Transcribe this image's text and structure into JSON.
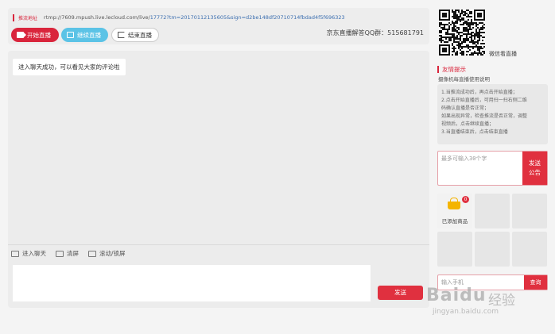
{
  "header": {
    "stream_label": "推流地址",
    "stream_prefix": "rtmp://7609.mpush.live.lecloud.com/live/",
    "stream_params": "17772?tm=20170112135605&sign=d2be148df20710714fbdad4f5f696323",
    "buttons": {
      "start": "开始直播",
      "continue": "继续直播",
      "end": "结束直播"
    },
    "qq_text": "京东直播解答QQ群：515681791"
  },
  "chat": {
    "message": "进入聊天成功，可以看见大家的评论啦",
    "toolbar": [
      "进入聊天",
      "清屏",
      "滚动/锁屏"
    ],
    "send_label": "发送"
  },
  "sidebar": {
    "qr_caption": "微信看直播",
    "tips_title": "友情提示",
    "tips_subtitle": "摄像机每直播使用说明",
    "tips_lines": [
      "1.当推流成功后，再点击开始直播；",
      "2.点击开始直播后，可用扫一扫右侧二维",
      "码确认直播是否正常；",
      "如果出现异常，检查推流是否正常，调整",
      "视频后，点击继续直播；",
      "3.当直播结束后，点击结束直播"
    ],
    "notice_placeholder": "最多可输入30个字",
    "notice_button": [
      "发送",
      "公告"
    ],
    "products_label": "已添加商品",
    "products_badge": "0",
    "search_placeholder": "输入手机",
    "search_button": "查询"
  },
  "watermark": {
    "brand": "Baidu",
    "cn": "经验",
    "url": "jingyan.baidu.com"
  },
  "colors": {
    "accent": "#e0303f",
    "cyan": "#5bc3e6",
    "link": "#3c6fb0"
  },
  "icons": [
    "video-camera-icon",
    "continue-icon",
    "exit-icon",
    "chat-icon",
    "monitor-icon",
    "scroll-icon",
    "basket-icon"
  ]
}
